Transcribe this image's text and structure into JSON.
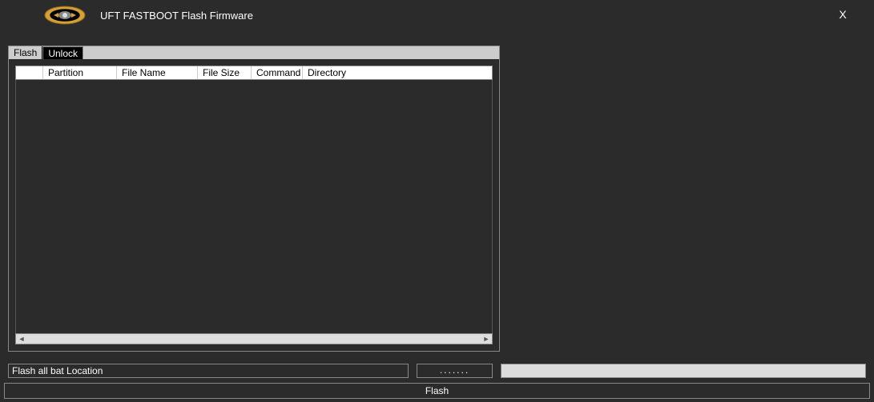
{
  "header": {
    "title": "UFT FASTBOOT Flash Firmware",
    "close": "X"
  },
  "tabs": {
    "flash": "Flash",
    "unlock": "Unlock"
  },
  "table": {
    "columns": {
      "partition": "Partition",
      "filename": "File Name",
      "filesize": "File Size",
      "command": "Command",
      "directory": "Directory"
    }
  },
  "footer": {
    "location_value": "Flash all bat Location",
    "browse_label": ".......",
    "flash_button": "Flash"
  }
}
